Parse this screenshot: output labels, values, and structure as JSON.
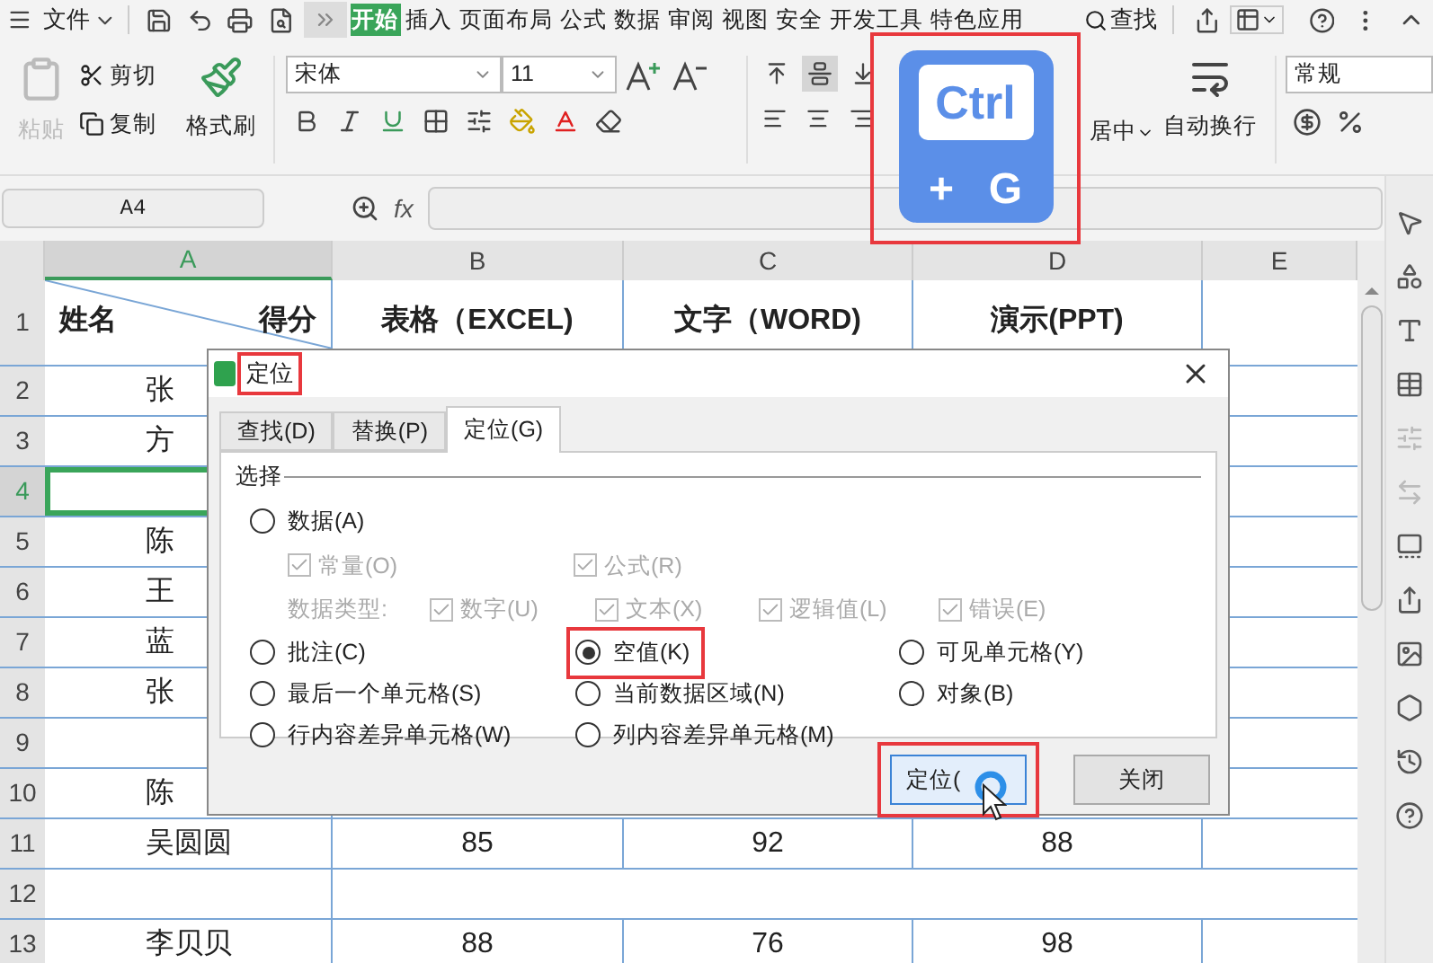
{
  "menu_bar": {
    "file": "文件",
    "tabs": [
      {
        "label": "开始",
        "selected": true
      },
      {
        "label": "插入",
        "selected": false
      },
      {
        "label": "页面布局",
        "selected": false
      },
      {
        "label": "公式",
        "selected": false
      },
      {
        "label": "数据",
        "selected": false
      },
      {
        "label": "审阅",
        "selected": false
      },
      {
        "label": "视图",
        "selected": false
      },
      {
        "label": "安全",
        "selected": false
      },
      {
        "label": "开发工具",
        "selected": false
      },
      {
        "label": "特色应用",
        "selected": false
      }
    ],
    "search": "查找"
  },
  "toolbar": {
    "paste": {
      "label": "粘贴",
      "disabled": true
    },
    "cut": "剪切",
    "copy": "复制",
    "format_painter": "格式刷",
    "font": "宋体",
    "font_size": "11",
    "valign": [
      {
        "selected": false
      },
      {
        "selected": true
      },
      {
        "selected": false
      }
    ],
    "merge_center": "居中",
    "wrap_text": "自动换行",
    "number_format": "常规"
  },
  "shortcut_overlay": {
    "key": "Ctrl",
    "plus": "+",
    "letter": "G"
  },
  "formula_bar": {
    "cell_ref": "A4",
    "fx": "fx"
  },
  "sheet": {
    "columns": [
      {
        "label": "A",
        "selected": true
      },
      {
        "label": "B",
        "selected": false
      },
      {
        "label": "C",
        "selected": false
      },
      {
        "label": "D",
        "selected": false
      },
      {
        "label": "E",
        "selected": false
      }
    ],
    "header_row_number": "1",
    "corner": {
      "left": "姓名",
      "right": "得分"
    },
    "header_cells": [
      "表格（EXCEL)",
      "文字（WORD)",
      "演示(PPT)"
    ],
    "rows": [
      {
        "number": "2",
        "selected": false,
        "name": "张"
      },
      {
        "number": "3",
        "selected": false,
        "name": "方"
      },
      {
        "number": "4",
        "selected": true
      },
      {
        "number": "5",
        "selected": false,
        "name": "陈"
      },
      {
        "number": "6",
        "selected": false,
        "name": "王"
      },
      {
        "number": "7",
        "selected": false,
        "name": "蓝"
      },
      {
        "number": "8",
        "selected": false,
        "name": "张"
      },
      {
        "number": "9",
        "selected": false
      },
      {
        "number": "10",
        "selected": false,
        "name": "陈"
      },
      {
        "number": "11",
        "selected": false,
        "name": "吴圆圆",
        "values": [
          "85",
          "92",
          "88"
        ]
      },
      {
        "number": "12",
        "selected": false
      },
      {
        "number": "13",
        "selected": false,
        "name": "李贝贝",
        "values": [
          "88",
          "76",
          "98"
        ]
      }
    ]
  },
  "dialog": {
    "title": "定位",
    "tabs": [
      {
        "label": "查找(D)",
        "selected": false
      },
      {
        "label": "替换(P)",
        "selected": false
      },
      {
        "label": "定位(G)",
        "selected": true
      }
    ],
    "group": "选择",
    "data_radio": {
      "label": "数据(A)",
      "selected": false
    },
    "data_checks": [
      {
        "label": "常量(O)",
        "checked": true,
        "disabled": true
      },
      {
        "label": "公式(R)",
        "checked": true,
        "disabled": true
      }
    ],
    "type_label": "数据类型:",
    "type_checks": [
      {
        "label": "数字(U)",
        "checked": true,
        "disabled": true
      },
      {
        "label": "文本(X)",
        "checked": true,
        "disabled": true
      },
      {
        "label": "逻辑值(L)",
        "checked": true,
        "disabled": true
      },
      {
        "label": "错误(E)",
        "checked": true,
        "disabled": true
      }
    ],
    "radios": [
      {
        "label": "批注(C)",
        "selected": false,
        "highlighted": false
      },
      {
        "label": "空值(K)",
        "selected": true,
        "highlighted": true
      },
      {
        "label": "可见单元格(Y)",
        "selected": false,
        "highlighted": false
      },
      {
        "label": "最后一个单元格(S)",
        "selected": false,
        "highlighted": false
      },
      {
        "label": "当前数据区域(N)",
        "selected": false,
        "highlighted": false
      },
      {
        "label": "对象(B)",
        "selected": false,
        "highlighted": false
      },
      {
        "label": "行内容差异单元格(W)",
        "selected": false,
        "highlighted": false
      },
      {
        "label": "列内容差异单元格(M)",
        "selected": false,
        "highlighted": false
      }
    ],
    "buttons": [
      {
        "label": "定位(",
        "highlighted": true
      },
      {
        "label": "关闭",
        "highlighted": false
      }
    ]
  }
}
